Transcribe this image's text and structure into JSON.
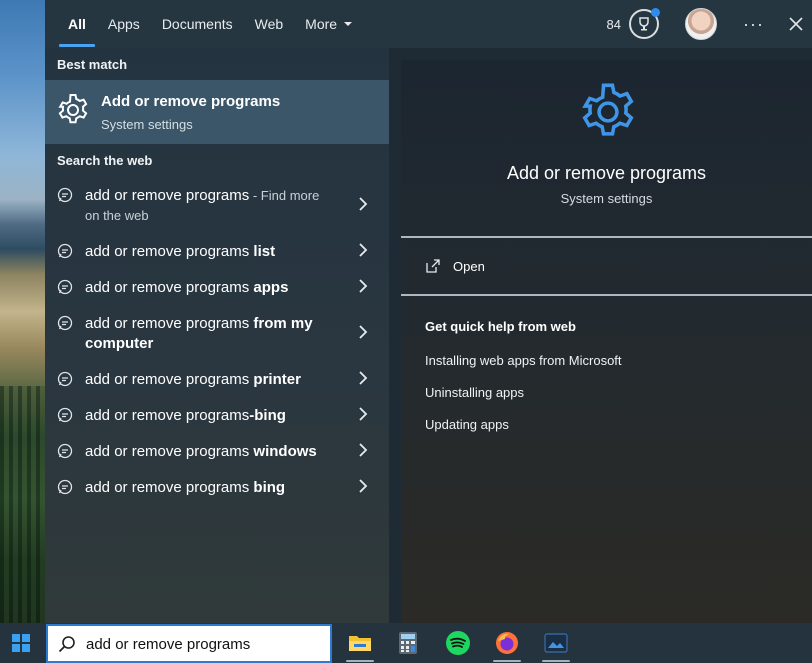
{
  "tabs": [
    {
      "label": "All",
      "active": true
    },
    {
      "label": "Apps"
    },
    {
      "label": "Documents"
    },
    {
      "label": "Web"
    },
    {
      "label": "More"
    }
  ],
  "header": {
    "points": "84",
    "rewards_icon": "trophy-icon",
    "more_icon": "ellipsis-icon",
    "close_icon": "close-icon"
  },
  "best_match": {
    "section_label": "Best match",
    "title": "Add or remove programs",
    "subtitle": "System settings",
    "icon": "gear-icon"
  },
  "web": {
    "section_label": "Search web",
    "section_label_full": "Search the web",
    "items": [
      {
        "prefix": "add or remove programs",
        "bold": "",
        "hint": " - Find more",
        "line2": "on the web"
      },
      {
        "prefix": "add or remove programs ",
        "bold": "list",
        "hint": "",
        "line2": ""
      },
      {
        "prefix": "add or remove programs ",
        "bold": "apps",
        "hint": "",
        "line2": ""
      },
      {
        "prefix": "add or remove programs ",
        "bold": "from my",
        "hint": "",
        "line2": "computer"
      },
      {
        "prefix": "add or remove programs ",
        "bold": "printer",
        "hint": "",
        "line2": ""
      },
      {
        "prefix": "add or remove programs",
        "bold": "-bing",
        "hint": "",
        "line2": ""
      },
      {
        "prefix": "add or remove programs ",
        "bold": "windows",
        "hint": "",
        "line2": ""
      },
      {
        "prefix": "add or remove programs ",
        "bold": "bing",
        "hint": "",
        "line2": ""
      }
    ]
  },
  "preview": {
    "title": "Add or remove programs",
    "subtitle": "System settings",
    "open_label": "Open",
    "quick_help_title": "Get quick help from web",
    "links": [
      "Installing web apps from Microsoft",
      "Uninstalling apps",
      "Updating apps"
    ]
  },
  "search": {
    "value": "add or remove programs"
  },
  "taskbar": {
    "apps": [
      "file-explorer-icon",
      "calculator-icon",
      "spotify-icon",
      "firefox-icon",
      "photos-icon"
    ]
  },
  "colors": {
    "accent": "#4aa3f0",
    "selected_row": "#3a5668",
    "search_border": "#2b7bd1"
  }
}
